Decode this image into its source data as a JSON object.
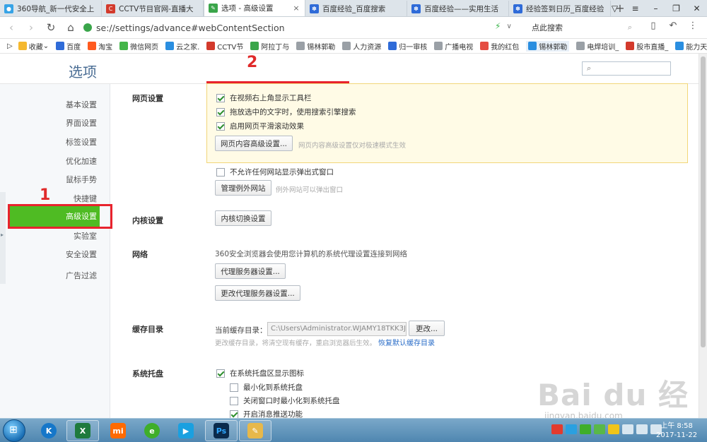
{
  "browser": {
    "tabs": [
      {
        "label": "360导航_新一代安全上",
        "fav_color": "#36a3e6",
        "active": false
      },
      {
        "label": "CCTV节目官网-直播大",
        "fav_color": "#d33a2c",
        "active": false
      },
      {
        "label": "选项 - 高级设置",
        "fav_color": "#3aa54a",
        "active": true
      },
      {
        "label": "百度经验_百度搜索",
        "fav_color": "#2f6bd8",
        "active": false
      },
      {
        "label": "百度经验——实用生活",
        "fav_color": "#2f6bd8",
        "active": false
      },
      {
        "label": "经验签到日历_百度经验",
        "fav_color": "#2f6bd8",
        "active": false
      }
    ],
    "url": "se://settings/advance#webContentSection",
    "search_value": "点此搜索",
    "bookmarks": [
      {
        "label": "收藏",
        "color": "#f5b82e"
      },
      {
        "label": "百度",
        "color": "#2f6bd8"
      },
      {
        "label": "淘宝",
        "color": "#ff5a1f"
      },
      {
        "label": "微信网页",
        "color": "#44b549"
      },
      {
        "label": "云之家.",
        "color": "#2a8ee0"
      },
      {
        "label": "CCTV节",
        "color": "#d33a2c"
      },
      {
        "label": "阿拉丁与",
        "color": "#3aa54a"
      },
      {
        "label": "锡林郭勒",
        "color": "#9aa0a6"
      },
      {
        "label": "人力资源",
        "color": "#9aa0a6"
      },
      {
        "label": "归一审核",
        "color": "#2f6bd8"
      },
      {
        "label": "广播电视",
        "color": "#9aa0a6"
      },
      {
        "label": "我的红包",
        "color": "#e54d42"
      },
      {
        "label": "锡林郭勒",
        "color": "#2a8ee0"
      },
      {
        "label": "电焊培训_",
        "color": "#9aa0a6"
      },
      {
        "label": "股市直播_",
        "color": "#d33a2c"
      },
      {
        "label": "能力天空",
        "color": "#2a8ee0"
      }
    ]
  },
  "page": {
    "title": "选项",
    "sidebar": [
      {
        "label": "基本设置",
        "active": false
      },
      {
        "label": "界面设置",
        "active": false
      },
      {
        "label": "标签设置",
        "active": false
      },
      {
        "label": "优化加速",
        "active": false
      },
      {
        "label": "鼠标手势",
        "active": false
      },
      {
        "label": "快捷键",
        "active": false
      },
      {
        "label": "高级设置",
        "active": true
      },
      {
        "label": "实验室",
        "active": false
      },
      {
        "label": "安全设置",
        "active": false
      },
      {
        "label": "广告过滤",
        "active": false
      }
    ],
    "annotations": {
      "one": "1",
      "two": "2"
    },
    "web_section": {
      "label": "网页设置",
      "cb_toolbar": "在视频右上角显示工具栏",
      "cb_drag_search": "拖放选中的文字时，使用搜索引擎搜索",
      "cb_smooth_scroll": "启用网页平滑滚动效果",
      "advanced_btn": "网页内容高级设置...",
      "advanced_hint": "网页内容高级设置仅对极速模式生效",
      "cb_no_popup": "不允许任何网站显示弹出式窗口",
      "exceptions_btn": "管理例外网站",
      "exceptions_hint": "例外网站可以弹出窗口"
    },
    "kernel_section": {
      "label": "内核设置",
      "btn": "内核切换设置"
    },
    "network_section": {
      "label": "网络",
      "desc": "360安全浏览器会使用您计算机的系统代理设置连接到网络",
      "proxy_btn": "代理服务器设置...",
      "change_proxy_btn": "更改代理服务器设置..."
    },
    "cache_section": {
      "label": "缓存目录",
      "current_label": "当前缓存目录：",
      "path": "C:\\Users\\Administrator.WJAMY18TKK3JYJ",
      "change_btn": "更改...",
      "hint": "更改缓存目录，将清空现有缓存，重启浏览器后生效。",
      "restore_link": "恢复默认缓存目录"
    },
    "tray_section": {
      "label": "系统托盘",
      "cb_show_icon": "在系统托盘区显示图标",
      "cb_minimize": "最小化到系统托盘",
      "cb_close_minimize": "关闭窗口时最小化到系统托盘",
      "cb_push": "开启消息推送功能"
    }
  },
  "watermark": {
    "brand": "Bai du 经验",
    "url": "jingyan.baidu.com"
  },
  "taskbar": {
    "time": "上午 8:58",
    "date": "2017-11-22"
  }
}
